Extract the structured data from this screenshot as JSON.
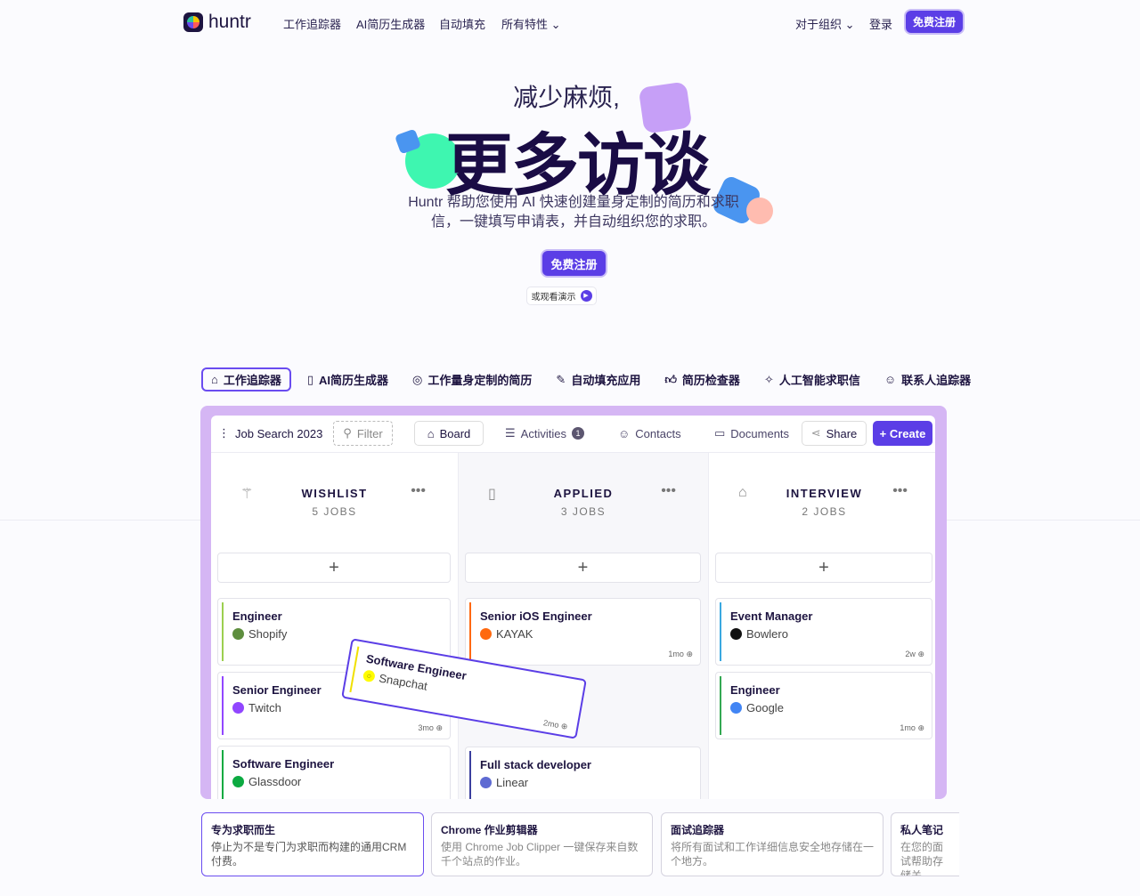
{
  "nav": {
    "brand": "huntr",
    "links": [
      "工作追踪器",
      "AI简历生成器",
      "自动填充",
      "所有特性"
    ],
    "org": "对于组织",
    "login": "登录",
    "signup": "免费注册"
  },
  "hero": {
    "line1": "减少麻烦,",
    "line2": "更多访谈",
    "desc1": "Huntr 帮助您使用 AI 快速创建量身定制的简历和求职",
    "desc2": "信，一键填写申请表，并自动组织您的求职。",
    "cta": "免费注册",
    "demo": "或观看演示"
  },
  "tabs": [
    "工作追踪器",
    "AI简历生成器",
    "工作量身定制的简历",
    "自动填充应用",
    "简历检查器",
    "人工智能求职信",
    "联系人追踪器"
  ],
  "toolbar": {
    "board_name": "Job Search 2023",
    "filter": "Filter",
    "board": "Board",
    "activities": "Activities",
    "activities_count": "1",
    "contacts": "Contacts",
    "documents": "Documents",
    "share": "Share",
    "create": "+ Create"
  },
  "columns": [
    {
      "title": "WISHLIST",
      "count": "5 JOBS",
      "cards": [
        {
          "title": "Engineer",
          "company": "Shopify",
          "color": "#9ccf4f",
          "logo": "#5e8e3e",
          "time": ""
        },
        {
          "title": "Senior Engineer",
          "company": "Twitch",
          "color": "#9146ff",
          "logo": "#9146ff",
          "time": "3mo"
        },
        {
          "title": "Software Engineer",
          "company": "Glassdoor",
          "color": "#0caa41",
          "logo": "#0caa41",
          "time": ""
        }
      ]
    },
    {
      "title": "APPLIED",
      "count": "3 JOBS",
      "cards": [
        {
          "title": "Senior iOS Engineer",
          "company": "KAYAK",
          "color": "#ff690f",
          "logo": "#ff690f",
          "time": "1mo"
        },
        {
          "title": "Full stack developer",
          "company": "Linear",
          "color": "#3b3f9e",
          "logo": "#5e6ad2",
          "time": ""
        }
      ]
    },
    {
      "title": "INTERVIEW",
      "count": "2 JOBS",
      "cards": [
        {
          "title": "Event Manager",
          "company": "Bowlero",
          "color": "#3aa8e0",
          "logo": "#111111",
          "time": "2w"
        },
        {
          "title": "Engineer",
          "company": "Google",
          "color": "#34a853",
          "logo": "#4285f4",
          "time": "1mo"
        }
      ]
    }
  ],
  "dragged": {
    "title": "Software Engineer",
    "company": "Snapchat",
    "time": "2mo",
    "color": "#fffc00"
  },
  "features": [
    {
      "h": "专为求职而生",
      "d": "停止为不是专门为求职而构建的通用CRM付费。"
    },
    {
      "h": "Chrome 作业剪辑器",
      "d": "使用 Chrome Job Clipper 一键保存来自数千个站点的作业。"
    },
    {
      "h": "面试追踪器",
      "d": "将所有面试和工作详细信息安全地存储在一个地方。"
    },
    {
      "h": "私人笔记",
      "d": "在您的面试帮助存储关"
    }
  ],
  "colors": {
    "accent": "#5b3ee6",
    "board_bg": "#d5b6f4"
  }
}
